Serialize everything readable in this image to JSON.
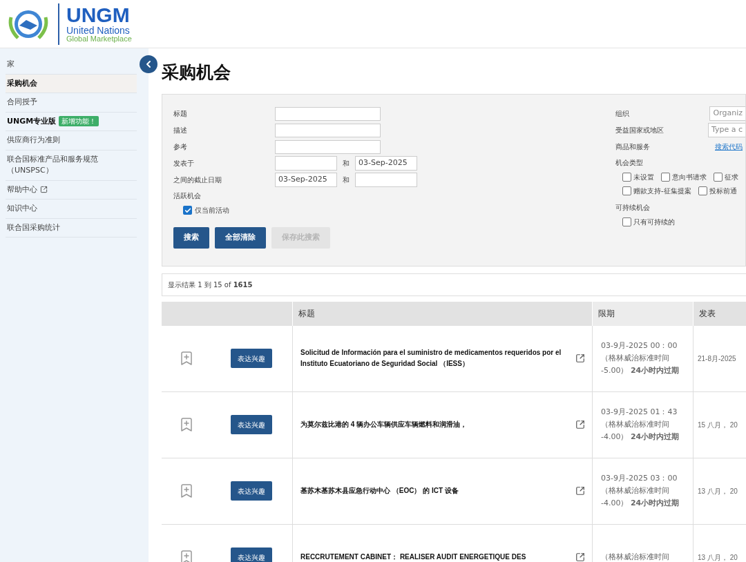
{
  "header": {
    "logo_title": "UNGM",
    "logo_line1": "United Nations",
    "logo_line2": "Global Marketplace"
  },
  "sidebar": {
    "items": [
      {
        "label": "家",
        "selected": false
      },
      {
        "label": "采购机会",
        "selected": true
      },
      {
        "label": "合同授予",
        "selected": false
      },
      {
        "label": "UNGM专业版",
        "selected": false,
        "bold": true,
        "badge": "新增功能！"
      },
      {
        "label": "供应商行为准则",
        "selected": false
      },
      {
        "label": "联合国标准产品和服务规范（UNSPSC）",
        "selected": false
      },
      {
        "label": "帮助中心",
        "selected": false,
        "external": true
      },
      {
        "label": "知识中心",
        "selected": false
      },
      {
        "label": "联合国采购统计",
        "selected": false
      }
    ]
  },
  "page_title": "采购机会",
  "search_form": {
    "left_fields": [
      {
        "label": "标题",
        "kind": "text"
      },
      {
        "label": "描述",
        "kind": "text"
      },
      {
        "label": "参考",
        "kind": "text"
      },
      {
        "label": "发表于",
        "kind": "range",
        "joiner": "和",
        "to": "03-Sep-2025"
      },
      {
        "label": "之间的截止日期",
        "kind": "range",
        "from": "03-Sep-2025",
        "joiner": "和"
      }
    ],
    "active": {
      "label": "活跃机会",
      "option": {
        "label": "仅当前活动",
        "checked": true
      }
    },
    "buttons": [
      {
        "label": "搜索",
        "disabled": false
      },
      {
        "label": "全部清除",
        "disabled": false
      },
      {
        "label": "保存此搜索",
        "disabled": true
      }
    ],
    "right_fields": [
      {
        "label": "组织",
        "placeholder": "Organiz"
      },
      {
        "label": "受益国家或地区",
        "placeholder": "Type a c"
      }
    ],
    "goods": {
      "label": "商品和服务",
      "link": "搜索代码"
    },
    "types": {
      "label": "机会类型",
      "lines": [
        {
          "options": [
            {
              "label": "未设置",
              "checked": false
            },
            {
              "label": "意向书请求",
              "checked": false
            },
            {
              "label": "征求",
              "checked": false
            }
          ]
        },
        {
          "options": [
            {
              "label": "赠款支持-征集提案",
              "checked": false
            },
            {
              "label": "投标前通",
              "checked": false
            }
          ]
        }
      ]
    },
    "sustainable": {
      "label": "可持续机会",
      "option": {
        "label": "只有可持续的",
        "checked": false
      }
    }
  },
  "results_summary": "显示结果 1 到 15 of **1615**",
  "table": {
    "columns": [
      "标题",
      "限期",
      "发表"
    ],
    "rows": [
      {
        "button": "表达兴趣",
        "title": "Solicitud de Información para el suministro de medicamentos requeridos por el Instituto Ecuatoriano de Seguridad Social （IESS）",
        "deadline": "03-9月-2025 00：00 （格林威治标准时间 -5.00） **24小时内过期**",
        "published": "21-8月-2025"
      },
      {
        "button": "表达兴趣",
        "title": "为莫尔兹比港的 4 辆办公车辆供应车辆燃料和润滑油，",
        "deadline": "03-9月-2025 01：43 （格林威治标准时间 -4.00） **24小时内过期**",
        "published": "15 八月， 20"
      },
      {
        "button": "表达兴趣",
        "title": "基苏木基苏木县应急行动中心 （EOC） 的 ICT 设备",
        "deadline": "03-9月-2025 03：00 （格林威治标准时间 -4.00） **24小时内过期**",
        "published": "13 八月， 20"
      },
      {
        "button": "表达兴趣",
        "title": "RECCRUTEMENT CABINET： REALISER AUDIT ENERGETIQUE DES",
        "deadline": "（格林威治标准时间",
        "published": "13 八月， 20"
      }
    ]
  }
}
